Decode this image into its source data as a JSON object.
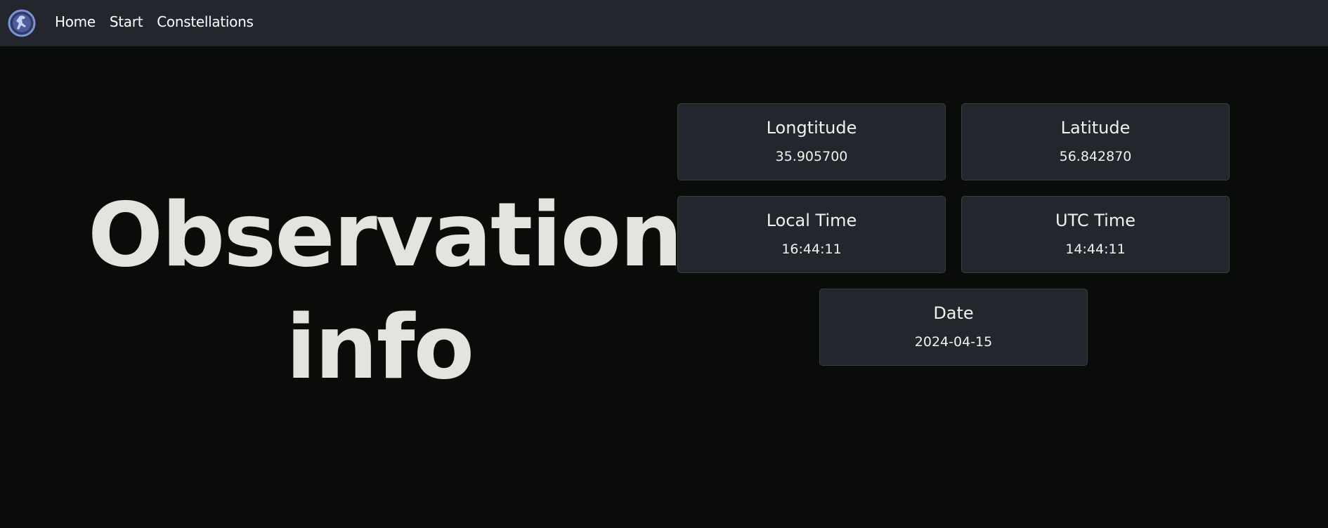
{
  "nav": {
    "logo_icon": "astronaut-logo-icon",
    "links": [
      "Home",
      "Start",
      "Constellations"
    ]
  },
  "hero": {
    "line1": "Observation",
    "line2": "info"
  },
  "cards": {
    "longitude": {
      "title": "Longtitude",
      "value": "35.905700"
    },
    "latitude": {
      "title": "Latitude",
      "value": "56.842870"
    },
    "local_time": {
      "title": "Local Time",
      "value": "16:44:11"
    },
    "utc_time": {
      "title": "UTC Time",
      "value": "14:44:11"
    },
    "date": {
      "title": "Date",
      "value": "2024-04-15"
    }
  },
  "colors": {
    "background": "#0a0c0a",
    "navbar": "#23262d",
    "card": "#23262d",
    "logo": "#6f86c8"
  }
}
